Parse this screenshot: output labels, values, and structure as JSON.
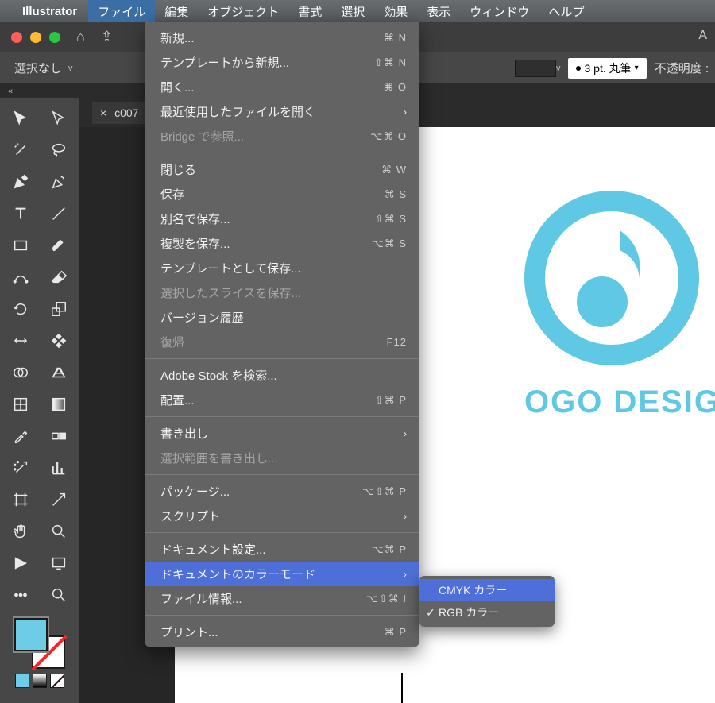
{
  "menubar": {
    "app": "Illustrator",
    "items": [
      "ファイル",
      "編集",
      "オブジェクト",
      "書式",
      "選択",
      "効果",
      "表示",
      "ウィンドウ",
      "ヘルプ"
    ],
    "active_index": 0
  },
  "window": {
    "right_char": "A"
  },
  "options": {
    "selection": "選択なし",
    "stroke": "3 pt. 丸筆",
    "opacity_label": "不透明度 :"
  },
  "tab": {
    "label": "c007-"
  },
  "color": {
    "fill": "#6ecde6",
    "accent": "#5fc8e4"
  },
  "canvas": {
    "text": "OGO DESIGN"
  },
  "menu": {
    "groups": [
      [
        {
          "label": "新規...",
          "shortcut": "⌘ N"
        },
        {
          "label": "テンプレートから新規...",
          "shortcut": "⇧⌘ N"
        },
        {
          "label": "開く...",
          "shortcut": "⌘ O"
        },
        {
          "label": "最近使用したファイルを開く",
          "sub": true
        },
        {
          "label": "Bridge で参照...",
          "shortcut": "⌥⌘ O",
          "disabled": true
        }
      ],
      [
        {
          "label": "閉じる",
          "shortcut": "⌘ W"
        },
        {
          "label": "保存",
          "shortcut": "⌘ S"
        },
        {
          "label": "別名で保存...",
          "shortcut": "⇧⌘ S"
        },
        {
          "label": "複製を保存...",
          "shortcut": "⌥⌘ S"
        },
        {
          "label": "テンプレートとして保存..."
        },
        {
          "label": "選択したスライスを保存...",
          "disabled": true
        },
        {
          "label": "バージョン履歴"
        },
        {
          "label": "復帰",
          "shortcut": "F12",
          "disabled": true
        }
      ],
      [
        {
          "label": "Adobe Stock を検索..."
        },
        {
          "label": "配置...",
          "shortcut": "⇧⌘ P"
        }
      ],
      [
        {
          "label": "書き出し",
          "sub": true
        },
        {
          "label": "選択範囲を書き出し...",
          "disabled": true
        }
      ],
      [
        {
          "label": "パッケージ...",
          "shortcut": "⌥⇧⌘ P"
        },
        {
          "label": "スクリプト",
          "sub": true
        }
      ],
      [
        {
          "label": "ドキュメント設定...",
          "shortcut": "⌥⌘ P"
        },
        {
          "label": "ドキュメントのカラーモード",
          "sub": true,
          "hover": true
        },
        {
          "label": "ファイル情報...",
          "shortcut": "⌥⇧⌘ I"
        }
      ],
      [
        {
          "label": "プリント...",
          "shortcut": "⌘ P"
        }
      ]
    ]
  },
  "submenu": {
    "items": [
      {
        "label": "CMYK カラー",
        "hover": true
      },
      {
        "label": "RGB カラー",
        "checked": true
      }
    ]
  },
  "tools": [
    "selection",
    "direct-selection",
    "magic-wand",
    "lasso",
    "pen",
    "curvature",
    "type",
    "line",
    "rectangle",
    "paintbrush",
    "shaper",
    "eraser",
    "rotate",
    "scale",
    "width",
    "free-transform",
    "shape-builder",
    "perspective",
    "mesh",
    "gradient",
    "eyedropper",
    "blend",
    "symbol-sprayer",
    "column-graph",
    "artboard",
    "slice",
    "hand",
    "zoom",
    "toggle-fill",
    "toggle-screen",
    "edit-toolbar",
    "search"
  ]
}
